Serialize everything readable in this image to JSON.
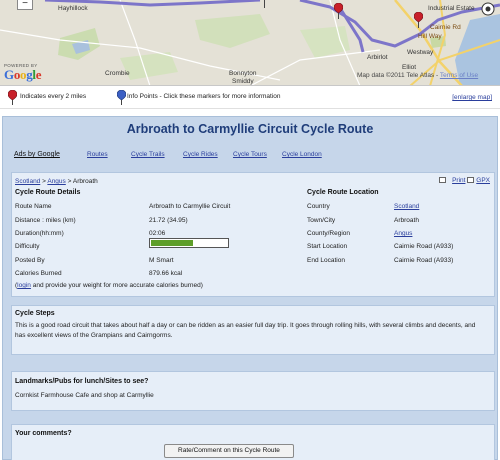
{
  "map": {
    "places": [
      "Hayhillock",
      "Crombie",
      "Bonnyton",
      "Smiddy",
      "Arbirlot",
      "Elliot",
      "Westway",
      "Industrial Estate",
      "Cairnie Rd",
      "Hill Way"
    ],
    "zoom_out": "−",
    "powered_by": "POWERED BY",
    "logo_letters": [
      "G",
      "o",
      "o",
      "g",
      "l",
      "e"
    ],
    "logo_colors": [
      "#3b6fd8",
      "#d8382b",
      "#e8b21a",
      "#3b6fd8",
      "#2e9a3a",
      "#d8382b"
    ],
    "copyright": "Map data ©2011 Tele Atlas -",
    "terms": "Terms of Use",
    "route_color": "#7d75c9"
  },
  "legend": {
    "marker_text": "Indicates every 2 miles",
    "info_text": "Info Points - Click these markers for more information",
    "enlarge": "[enlarge map]"
  },
  "page": {
    "title": "Arbroath to Carmyllie Circuit Cycle Route"
  },
  "ads": {
    "label": "Ads by Google",
    "links": [
      "Routes",
      "Cycle Trails",
      "Cycle Rides",
      "Cycle Tours",
      "Cycle London"
    ]
  },
  "breadcrumb": {
    "scotland": "Scotland",
    "sep": ">",
    "angus": "Angus",
    "current": "Arbroath"
  },
  "tools": {
    "print": "Print",
    "gpx": "GPX"
  },
  "details": {
    "heading": "Cycle Route Details",
    "rows": [
      {
        "label": "Route Name",
        "value": "Arbroath to Carmyllie Circuit"
      },
      {
        "label": "Distance : miles (km)",
        "value": "21.72  (34.95)"
      },
      {
        "label": "Duration(hh:mm)",
        "value": "02:06"
      },
      {
        "label": "Difficulty",
        "value": ""
      },
      {
        "label": "Posted By",
        "value": "M Smart"
      },
      {
        "label": "Calories Burned",
        "value": "879.66 kcal"
      }
    ],
    "difficulty_level": 0.55,
    "login_open": "(",
    "login_link": "login",
    "login_rest": " and provide your weight for more accurate calories burned)"
  },
  "location": {
    "heading": "Cycle Route Location",
    "rows": [
      {
        "label": "Country",
        "value": "Scotland",
        "link": true
      },
      {
        "label": "Town/City",
        "value": "Arbroath",
        "link": false
      },
      {
        "label": "County/Region",
        "value": "Angus",
        "link": true
      },
      {
        "label": "Start Location",
        "value": "Cairnie Road (A933)",
        "link": false
      },
      {
        "label": "End Location",
        "value": "Cairnie Road (A933)",
        "link": false
      }
    ]
  },
  "steps": {
    "title": "Cycle Steps",
    "text": "This is a good road circuit that takes about half a day or can be ridden as an easier full day trip. It goes through rolling hills, with several climbs and decents, and has excellent views of the Grampians and Cairngorms."
  },
  "landmarks": {
    "title": "Landmarks/Pubs for lunch/Sites to see?",
    "text": "Cornkist Farmhouse Cafe and shop at Carmyllie"
  },
  "comments": {
    "title": "Your comments?",
    "button": "Rate/Comment on this Cycle Route"
  }
}
